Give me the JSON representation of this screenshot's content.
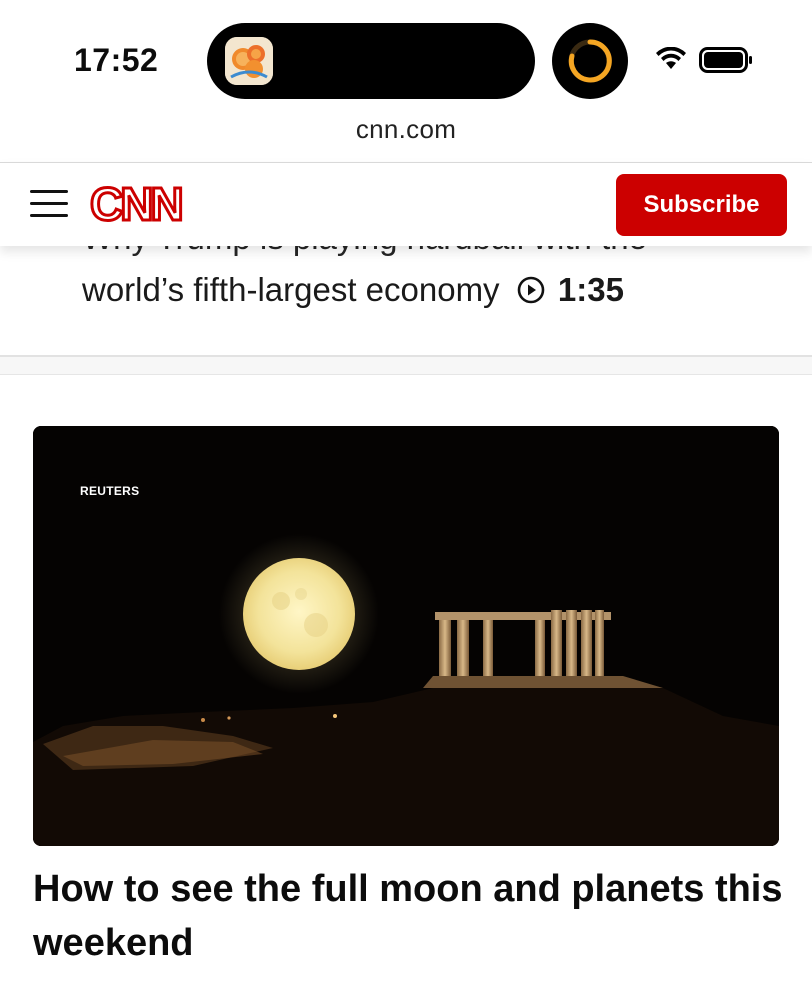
{
  "status_bar": {
    "time": "17:52",
    "url": "cnn.com"
  },
  "header": {
    "logo_text": "CNN",
    "subscribe_label": "Subscribe",
    "brand_color": "#cc0000"
  },
  "previous_story": {
    "title_line1": "Why Trump is playing hardball with the",
    "title_line2": "world’s fifth-largest economy",
    "duration": "1:35"
  },
  "feature": {
    "image_credit": "REUTERS",
    "headline": "How to see the full moon and planets this weekend"
  },
  "icons": {
    "menu": "hamburger-icon",
    "video": "play-circle-icon",
    "wifi": "wifi-icon",
    "battery": "battery-icon"
  }
}
